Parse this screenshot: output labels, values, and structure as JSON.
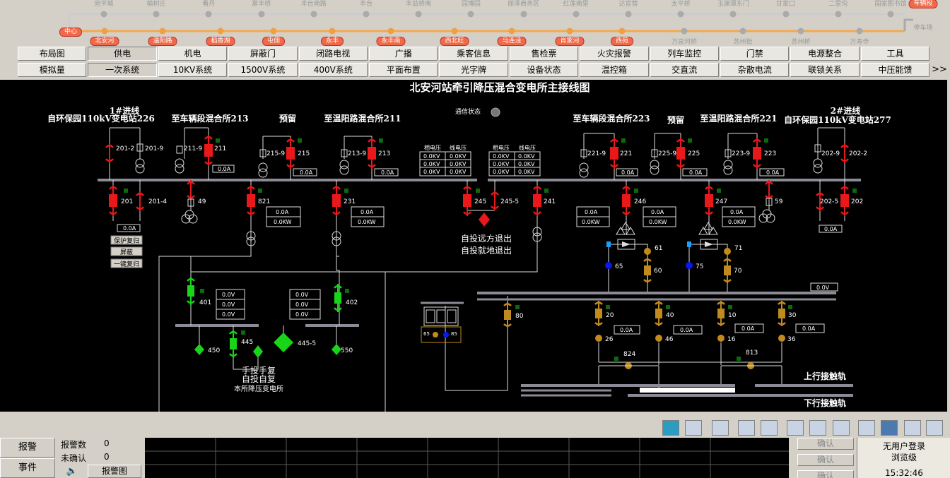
{
  "line_strip": {
    "top_stations": [
      "宛平城",
      "榆树庄",
      "看丹",
      "富丰桥",
      "丰台南路",
      "丰台",
      "丰益桥南",
      "园博园",
      "丽泽商务区",
      "红莲南里",
      "达官营",
      "太平桥",
      "玉渊潭东门",
      "甘家口",
      "二里沟",
      "国家图书馆"
    ],
    "bottom_plain": [
      "万泉河桥",
      "苏州街",
      "苏州桥",
      "万寿寺"
    ],
    "bottom_pills": [
      "北安河",
      "温阳路",
      "稻香湖",
      "屯佃",
      "永丰",
      "永丰南",
      "西北旺",
      "马连洼",
      "肖家河",
      "西苑"
    ],
    "center_label": "中心",
    "depot_label": "车辆段",
    "parking_label": "停车场"
  },
  "menu_row1": [
    "布局图",
    "供电",
    "机电",
    "屏蔽门",
    "闭路电视",
    "广播",
    "乘客信息",
    "售检票",
    "火灾报警",
    "列车监控",
    "门禁",
    "电源整合",
    "工具"
  ],
  "menu_row2": [
    "模拟量",
    "一次系统",
    "10KV系统",
    "1500V系统",
    "400V系统",
    "平面布置",
    "光字牌",
    "设备状态",
    "温控箱",
    "交直流",
    "杂散电流",
    "联锁关系",
    "中压能馈"
  ],
  "menu_more": ">>",
  "diagram": {
    "title": "北安河站牵引降压混合变电所主接线图",
    "comm_status": "通信状态",
    "feeders_left": {
      "line1_title": "1#进线",
      "line1_sub": "自环保园110kV变电站226",
      "f213": "至车辆段混合所213",
      "reserve": "预留",
      "f211": "至温阳路混合所211"
    },
    "feeders_right": {
      "f223": "至车辆段混合所223",
      "reserve": "预留",
      "f221": "至温阳路混合所221",
      "line2_title": "2#进线",
      "line2_sub": "自环保园110kV变电站277"
    },
    "switch_ids": {
      "s201_2": "201-2",
      "s201_9": "201-9",
      "s211_9": "211-9",
      "s211": "211",
      "s215_9": "215-9",
      "s215": "215",
      "s213_9": "213-9",
      "s213": "213",
      "s221_9": "221-9",
      "s221": "221",
      "s225_9": "225-9",
      "s225": "225",
      "s223_9": "223-9",
      "s223": "223",
      "s202_9": "202-9",
      "s202_2": "202-2",
      "s201": "201",
      "s201_4": "201-4",
      "s49": "49",
      "s821": "821",
      "s231": "231",
      "s245": "245",
      "s245_5": "245-5",
      "s241": "241",
      "s246": "246",
      "s247": "247",
      "s59": "59",
      "s202_5": "202-5",
      "s202": "202",
      "s61": "61",
      "s65": "65",
      "s60": "60",
      "s71": "71",
      "s75": "75",
      "s70": "70",
      "s80": "80",
      "s20": "20",
      "s26": "26",
      "s40": "40",
      "s46": "46",
      "s10": "10",
      "s16": "16",
      "s30": "30",
      "s36": "36",
      "s824": "824",
      "s813": "813",
      "s401": "401",
      "s402": "402",
      "s445": "445",
      "s445_5": "445-5",
      "s450": "450",
      "s550": "550",
      "s65b": "65",
      "s85": "85"
    },
    "readouts": {
      "current_0A": "0.0A",
      "power_0KW": "0.0KW",
      "volt_0V": "0.0V",
      "kv_0": "0.0KV"
    },
    "voltage_box_headers": [
      "相电压",
      "线电压"
    ],
    "auto_text": [
      "自投远方退出",
      "自投就地退出"
    ],
    "manual_text": [
      "手投手复",
      "自投自复"
    ],
    "local_sub": "本所降压变电所",
    "side_buttons": [
      "保护复归",
      "屏蔽",
      "一键复归"
    ],
    "rail_up": "上行接触轨",
    "rail_down": "下行接触轨"
  },
  "bottom": {
    "alarm_btn": "报警",
    "event_btn": "事件",
    "alarm_count_label": "报警数",
    "alarm_count": "0",
    "unconfirmed_label": "未确认",
    "unconfirmed": "0",
    "alarm_chart_btn": "报警图",
    "confirm_labels": [
      "确认",
      "确认",
      "确认"
    ],
    "user_status": "无用户登录",
    "role": "浏览级",
    "time": "15:32:46"
  },
  "colors": {
    "breaker_red": "#e8181b",
    "breaker_green": "#19d419",
    "breaker_brown": "#c08a1e",
    "bus_gray": "#8c8a94",
    "pill_orange": "#f06a4a"
  }
}
